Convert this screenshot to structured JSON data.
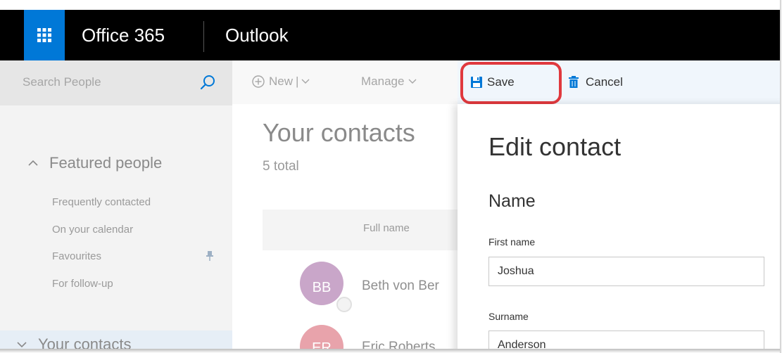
{
  "header": {
    "brand": "Office 365",
    "app_name": "Outlook",
    "waffle_icon": "app-launcher-icon",
    "brand_color": "#0078d7"
  },
  "sidebar": {
    "search": {
      "placeholder": "Search People",
      "value": ""
    },
    "featured": {
      "label": "Featured people",
      "items": [
        {
          "label": "Frequently contacted"
        },
        {
          "label": "On your calendar"
        },
        {
          "label": "Favourites",
          "icon": "pin-icon"
        },
        {
          "label": "For follow-up"
        }
      ]
    },
    "contacts": {
      "label": "Your contacts"
    }
  },
  "commands": {
    "new_label": "New",
    "manage_label": "Manage",
    "save_label": "Save",
    "cancel_label": "Cancel"
  },
  "contact_list": {
    "title": "Your contacts",
    "count": "5 total",
    "column_header": "Full name",
    "rows": [
      {
        "initials": "BB",
        "name": "Beth von Ber",
        "color": "#c9a6c9"
      },
      {
        "initials": "ER",
        "name": "Eric Roberts",
        "color": "#e8a3ab"
      }
    ]
  },
  "edit_panel": {
    "title": "Edit contact",
    "section": "Name",
    "fields": [
      {
        "label": "First name",
        "value": "Joshua"
      },
      {
        "label": "Surname",
        "value": "Anderson"
      }
    ]
  },
  "colors": {
    "highlight": "#e0393e",
    "save_icon": "#0078d7"
  }
}
